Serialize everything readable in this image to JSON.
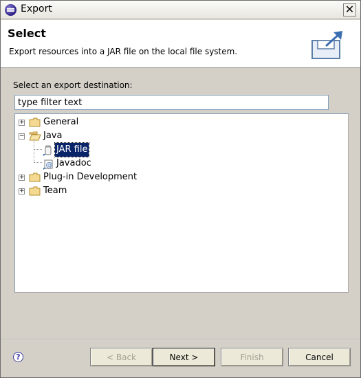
{
  "window": {
    "title": "Export"
  },
  "banner": {
    "title": "Select",
    "description": "Export resources into a JAR file on the local file system."
  },
  "destination": {
    "label": "Select an export destination:",
    "filter_value": "type filter text"
  },
  "tree": {
    "items": [
      {
        "label": "General",
        "expanded": false,
        "icon": "folder-icon"
      },
      {
        "label": "Java",
        "expanded": true,
        "icon": "open-folder-icon",
        "children": [
          {
            "label": "JAR file",
            "icon": "jar-icon",
            "selected": true
          },
          {
            "label": "Javadoc",
            "icon": "javadoc-icon",
            "selected": false
          }
        ]
      },
      {
        "label": "Plug-in Development",
        "expanded": false,
        "icon": "folder-icon"
      },
      {
        "label": "Team",
        "expanded": false,
        "icon": "folder-icon"
      }
    ]
  },
  "buttons": {
    "back": "< Back",
    "next": "Next >",
    "finish": "Finish",
    "cancel": "Cancel"
  },
  "colors": {
    "selection": "#0a246a",
    "dialog_bg": "#d4d0c8"
  }
}
